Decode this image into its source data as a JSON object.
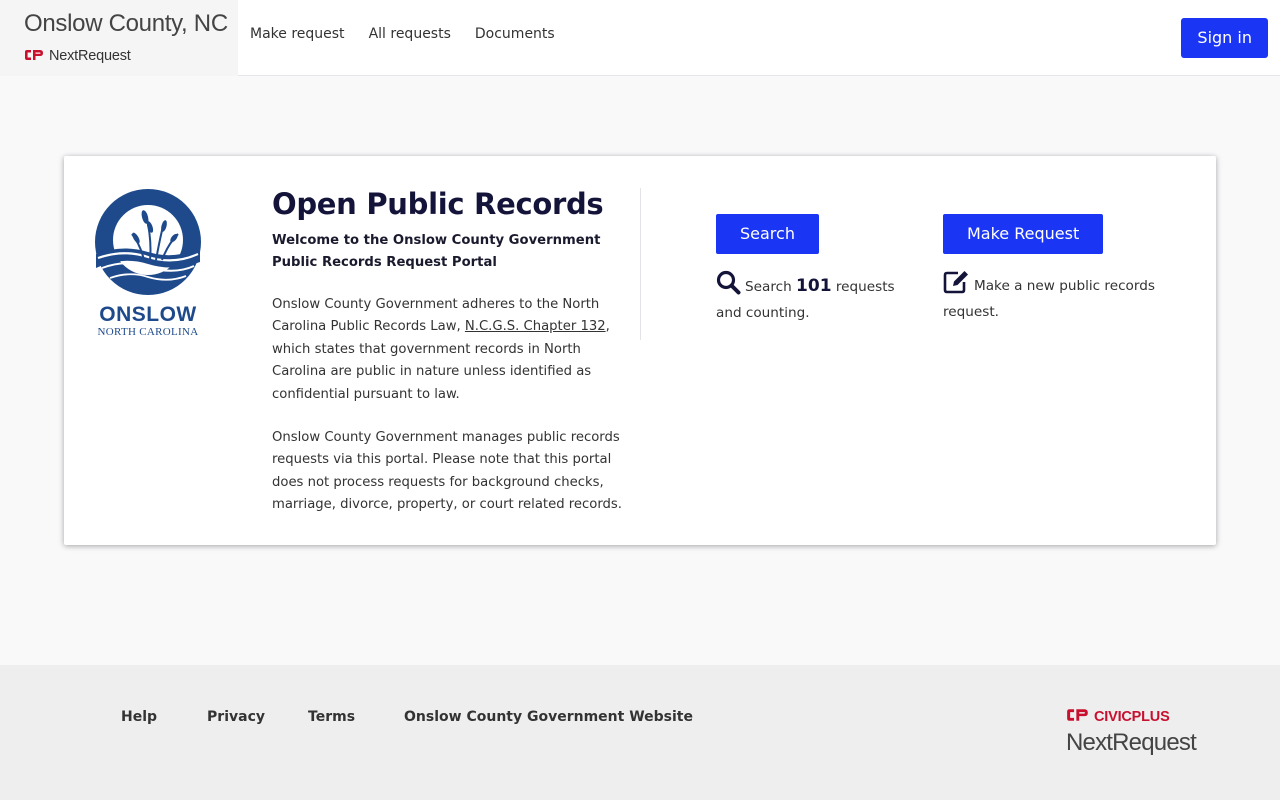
{
  "header": {
    "site_title": "Onslow County, NC",
    "brand_name": "NextRequest",
    "nav": [
      {
        "label": "Make request"
      },
      {
        "label": "All requests"
      },
      {
        "label": "Documents"
      }
    ],
    "signin_label": "Sign in"
  },
  "card": {
    "logo_word": "ONSLOW",
    "logo_sub": "NORTH CAROLINA",
    "title": "Open Public Records",
    "welcome": "Welcome to the Onslow County Government Public Records Request Portal",
    "para1_before": "Onslow County Government adheres to the North Carolina Public Records Law, ",
    "para1_link": "N.C.G.S. Chapter 132",
    "para1_after": ", which states that government records in North Carolina are public in nature unless identified as confidential pursuant to law.",
    "para2": "Onslow County Government manages public records requests via this portal. Please note that this portal does not process requests for background checks, marriage, divorce, property, or court related records.",
    "search": {
      "button_label": "Search",
      "icon": "search-icon",
      "desc_prefix": "Search",
      "count": "101",
      "desc_suffix": "requests and counting."
    },
    "make": {
      "button_label": "Make Request",
      "icon": "edit-icon",
      "desc": "Make a new public records request."
    }
  },
  "footer": {
    "links": [
      {
        "label": "Help"
      },
      {
        "label": "Privacy"
      },
      {
        "label": "Terms"
      },
      {
        "label": "Onslow County Government Website"
      }
    ],
    "brand_primary": "CIVICPLUS",
    "brand_secondary": "NextRequest"
  },
  "colors": {
    "accent": "#1b35f5",
    "brand_red": "#c8102e",
    "logo_blue": "#1e4a8c"
  }
}
